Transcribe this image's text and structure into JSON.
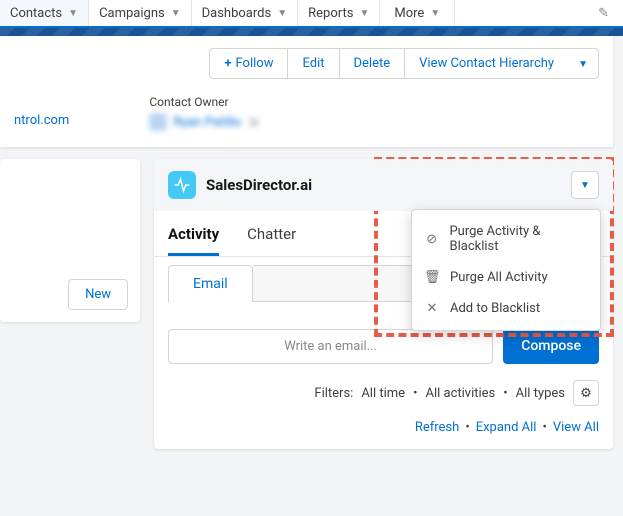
{
  "nav": {
    "contacts": "Contacts",
    "campaigns": "Campaigns",
    "dashboards": "Dashboards",
    "reports": "Reports",
    "more": "More"
  },
  "header": {
    "follow": "Follow",
    "edit": "Edit",
    "delete": "Delete",
    "hierarchy": "View Contact Hierarchy",
    "owner_label": "Contact Owner",
    "owner_name": "Ryan Patillo",
    "partial_link": "ntrol.com"
  },
  "leftcol": {
    "new": "New"
  },
  "widget": {
    "title": "SalesDirector.ai",
    "menu": {
      "purge_blacklist": "Purge Activity & Blacklist",
      "purge_all": "Purge All Activity",
      "add_blacklist": "Add to Blacklist"
    },
    "tabs": {
      "activity": "Activity",
      "chatter": "Chatter"
    },
    "subtabs": {
      "email": "Email"
    },
    "compose": {
      "placeholder": "Write an email...",
      "button": "Compose"
    },
    "filters": {
      "label": "Filters:",
      "time": "All time",
      "activities": "All activities",
      "types": "All types"
    },
    "links": {
      "refresh": "Refresh",
      "expand": "Expand All",
      "view": "View All"
    }
  }
}
